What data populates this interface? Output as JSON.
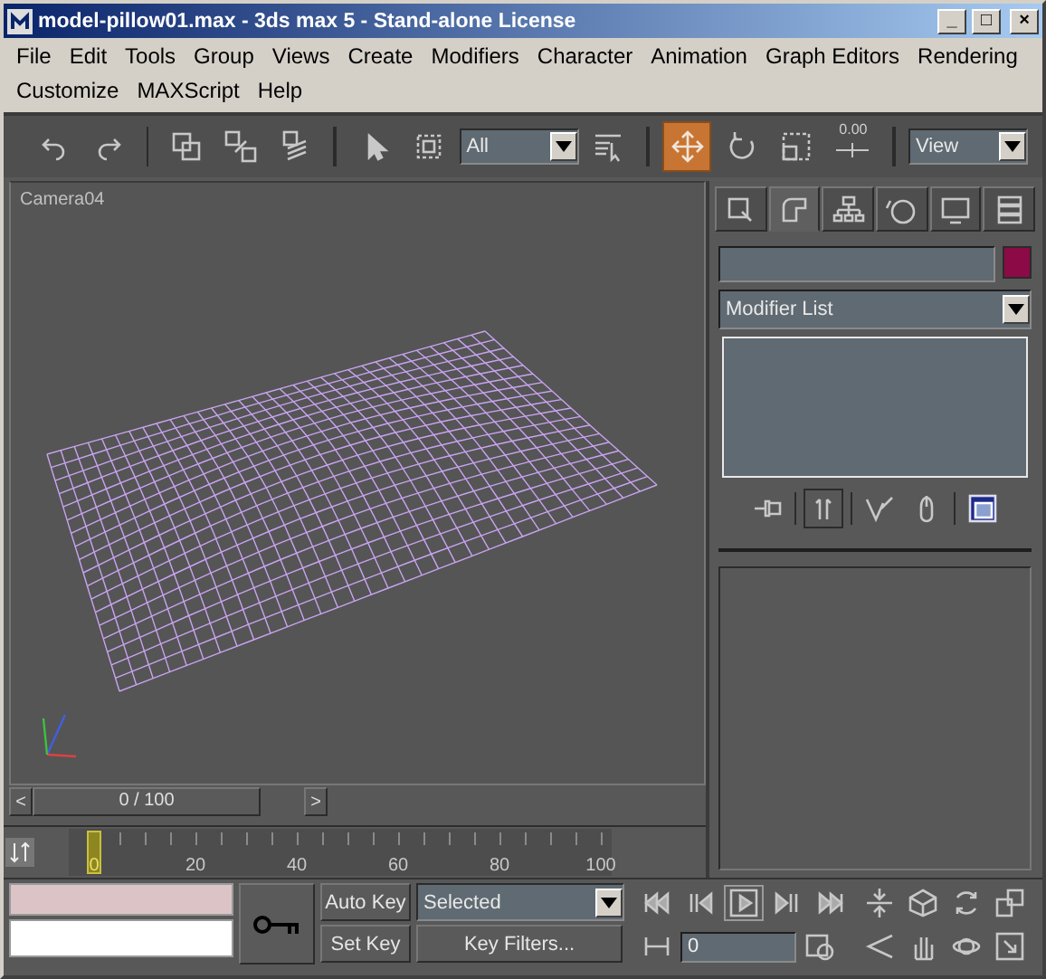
{
  "window": {
    "title": "model-pillow01.max - 3ds max 5 - Stand-alone License",
    "controls": [
      "_",
      "□",
      "×"
    ]
  },
  "menu": [
    "File",
    "Edit",
    "Tools",
    "Group",
    "Views",
    "Create",
    "Modifiers",
    "Character",
    "Animation",
    "Graph Editors",
    "Rendering",
    "Customize",
    "MAXScript",
    "Help"
  ],
  "toolbar": [
    {
      "kind": "button",
      "selected": false
    },
    {
      "kind": "button",
      "selected": false
    },
    {
      "kind": "separator"
    },
    {
      "kind": "button",
      "selected": false
    },
    {
      "kind": "button",
      "selected": false
    },
    {
      "kind": "button",
      "selected": false
    },
    {
      "kind": "separator"
    },
    {
      "kind": "button",
      "selected": false
    },
    {
      "kind": "button",
      "selected": false
    },
    {
      "kind": "dropdown",
      "value": "All"
    },
    {
      "kind": "button",
      "selected": false
    },
    {
      "kind": "separator"
    },
    {
      "kind": "button",
      "selected": true
    },
    {
      "kind": "button",
      "selected": false
    },
    {
      "kind": "button",
      "selected": false
    },
    {
      "kind": "labeled",
      "label": "0.00"
    },
    {
      "kind": "separator"
    },
    {
      "kind": "dropdown",
      "value": "View"
    }
  ],
  "viewport": {
    "label": "Camera04"
  },
  "time_slider": {
    "prev": "<",
    "text": "0 / 100",
    "next": ">",
    "level": 0
  },
  "track_bar": {
    "labels": [
      "0",
      "20",
      "40",
      "60",
      "80",
      "100"
    ],
    "level": 0
  },
  "command_panel": {
    "tabs": [
      {
        "selected": false
      },
      {
        "selected": true
      },
      {
        "selected": false
      },
      {
        "selected": false
      },
      {
        "selected": false
      },
      {
        "selected": false
      }
    ],
    "modifier_list": "Modifier List",
    "stack_buttons": [
      {
        "kind": "button",
        "selected": false
      },
      {
        "kind": "separator"
      },
      {
        "kind": "button",
        "selected": true
      },
      {
        "kind": "separator"
      },
      {
        "kind": "button",
        "selected": false
      },
      {
        "kind": "button",
        "selected": false
      },
      {
        "kind": "separator"
      },
      {
        "kind": "button",
        "selected": false
      }
    ]
  },
  "bottom": {
    "auto_key": "Auto Key",
    "set_key": "Set Key",
    "key_mode": "Selected",
    "key_filters": "Key Filters...",
    "frame": "0"
  }
}
